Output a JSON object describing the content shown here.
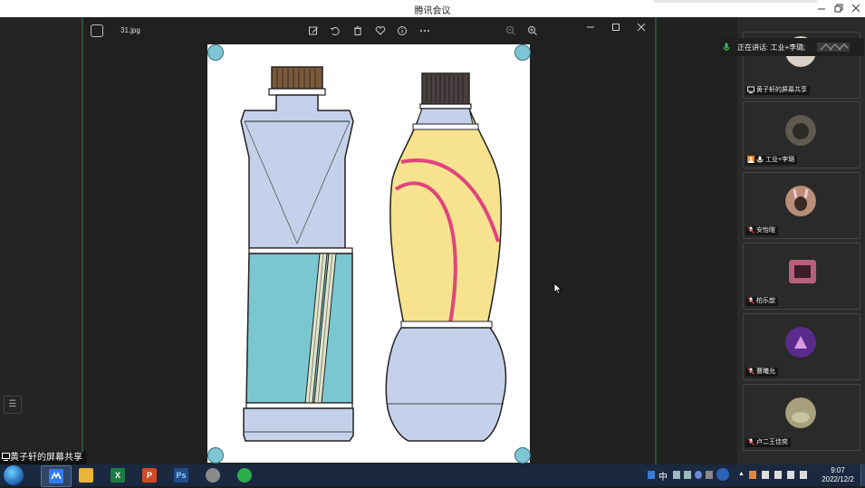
{
  "window": {
    "title": "腾讯会议"
  },
  "viewer": {
    "filename": "31.jpg",
    "toolbar_icons": [
      "edit-icon",
      "rotate-icon",
      "delete-icon",
      "favorite-icon",
      "info-icon",
      "more-icon"
    ],
    "zoom_icons": [
      "zoom-out-icon",
      "zoom-in-icon"
    ]
  },
  "speaking": {
    "label": "正在讲话: 工业+李璐;"
  },
  "participants": [
    {
      "name": "黄子轩的屏幕共享",
      "icon": "screen-share-icon",
      "avatar_color": "#d9d2c8"
    },
    {
      "name": "工业+李璐",
      "icon": "mic-icon",
      "avatar_color": "#5e5a4f"
    },
    {
      "name": "安怡暄",
      "icon": "muted-mic-icon",
      "avatar_color": "#b98e78"
    },
    {
      "name": "柏乐歆",
      "icon": "muted-mic-icon",
      "avatar_color": "#b85f7a"
    },
    {
      "name": "曹曦允",
      "icon": "muted-mic-icon",
      "avatar_color": "#5a2a8c"
    },
    {
      "name": "卢二王佳奕",
      "icon": "muted-mic-icon",
      "avatar_color": "#a7a07c"
    }
  ],
  "share_label": "黄子轩的屏幕共享",
  "taskbar": {
    "apps": [
      {
        "name": "tencent-meeting",
        "label": "",
        "color": "#2f7cf6",
        "active": true
      },
      {
        "name": "file-explorer",
        "label": "",
        "color": "#e8b53a",
        "active": false
      },
      {
        "name": "excel",
        "label": "X",
        "color": "#1e7b45",
        "active": false
      },
      {
        "name": "powerpoint",
        "label": "P",
        "color": "#d04a27",
        "active": false
      },
      {
        "name": "photoshop",
        "label": "Ps",
        "color": "#1f4d8a",
        "active": false
      },
      {
        "name": "game",
        "label": "",
        "color": "#8a8a8a",
        "active": false
      },
      {
        "name": "wechat",
        "label": "",
        "color": "#2aae4a",
        "active": false
      }
    ],
    "ime": "中",
    "time": "9:07",
    "date": "2022/12/2"
  }
}
